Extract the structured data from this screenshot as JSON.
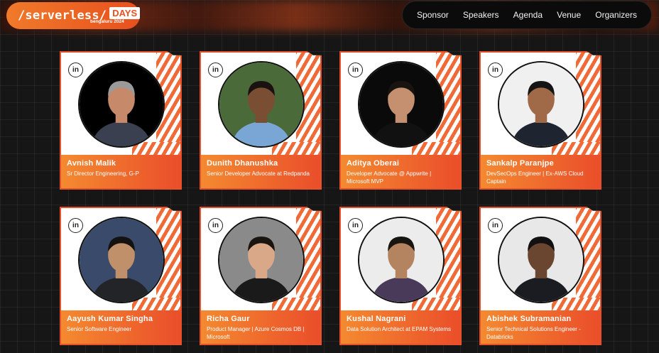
{
  "header": {
    "logo_main": "/serverless/",
    "logo_days": "DAYS",
    "logo_sub": "bengaluru 2024",
    "nav": [
      "Sponsor",
      "Speakers",
      "Agenda",
      "Venue",
      "Organizers"
    ]
  },
  "colors": {
    "accent": "#ea4e2a",
    "accent_light": "#f48a30",
    "background": "#161616"
  },
  "linkedin_glyph": "in",
  "speakers": [
    {
      "name": "Avnish Malik",
      "role": "Sr Director Engineering, G-P",
      "bg": "#000000",
      "skin": "#c68a6a",
      "shirt": "#3a4050",
      "hair": "#9a9a9a"
    },
    {
      "name": "Dunith Dhanushka",
      "role": "Senior Developer Advocate at Redpanda",
      "bg": "#4a6a3a",
      "skin": "#7a4e32",
      "shirt": "#7aa6d6",
      "hair": "#1a1210"
    },
    {
      "name": "Aditya Oberai",
      "role": "Developer Advocate @ Appwrite | Microsoft MVP",
      "bg": "#0a0a0a",
      "skin": "#c49070",
      "shirt": "#111111",
      "hair": "#1a1410"
    },
    {
      "name": "Sankalp Paranjpe",
      "role": "DevSecOps Engineer | Ex-AWS Cloud Captain",
      "bg": "#f0f0f0",
      "skin": "#a06a48",
      "shirt": "#1e2430",
      "hair": "#141414"
    },
    {
      "name": "Aayush Kumar Singha",
      "role": "Senior Software Engineer",
      "bg": "#3a4a6a",
      "skin": "#c0906a",
      "shirt": "#222428",
      "hair": "#141210"
    },
    {
      "name": "Richa Gaur",
      "role": "Product Manager | Azure Cosmos DB | Microsoft",
      "bg": "#8a8a8a",
      "skin": "#d8a888",
      "shirt": "#1a1a1a",
      "hair": "#1a1410"
    },
    {
      "name": "Kushal Nagrani",
      "role": "Data Solution Architect at EPAM Systems",
      "bg": "#ececec",
      "skin": "#b48460",
      "shirt": "#4a3a5a",
      "hair": "#181410"
    },
    {
      "name": "Abishek Subramanian",
      "role": "Senior Technical Solutions Engineer - Databricks",
      "bg": "#e8e8e8",
      "skin": "#6a4630",
      "shirt": "#1a1c22",
      "hair": "#121010"
    }
  ]
}
